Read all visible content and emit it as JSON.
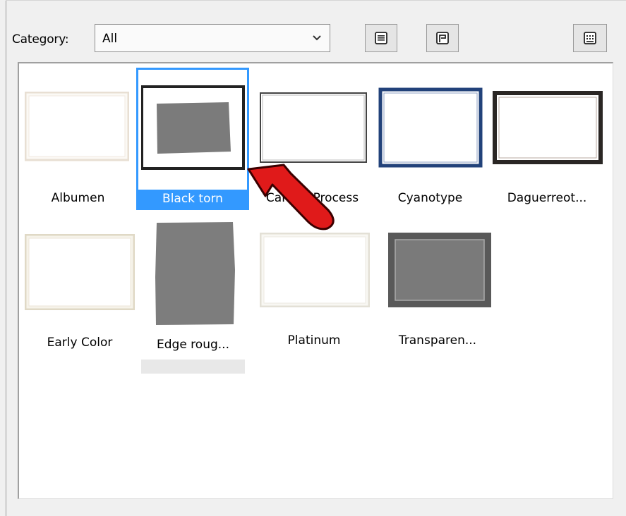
{
  "toolbar": {
    "category_label": "Category:",
    "category_value": "All"
  },
  "items": [
    {
      "label": "Albumen"
    },
    {
      "label": "Black torn",
      "selected": true
    },
    {
      "label": "Carbon Process"
    },
    {
      "label": "Cyanotype"
    },
    {
      "label": "Daguerreot..."
    },
    {
      "label": "Early Color"
    },
    {
      "label": "Edge roug...",
      "hovered": true
    },
    {
      "label": "Platinum"
    },
    {
      "label": "Transparen..."
    }
  ],
  "colors": {
    "selection": "#3399ff",
    "arrow": "#e01a1a"
  }
}
